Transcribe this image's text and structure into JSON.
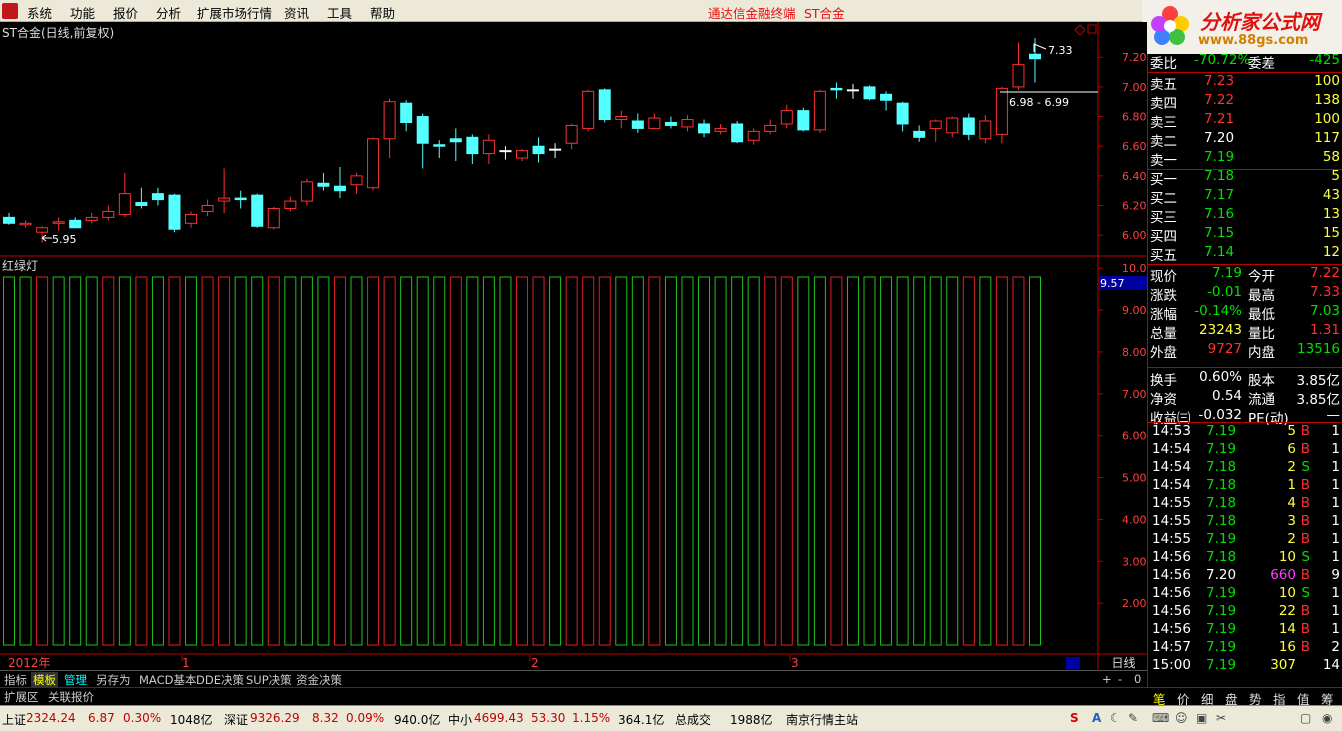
{
  "menu": [
    "系统",
    "功能",
    "报价",
    "分析",
    "扩展市场行情",
    "资讯",
    "工具",
    "帮助"
  ],
  "menu_center": [
    "通达信金融终端",
    "ST合金"
  ],
  "brand": {
    "title": "分析家公式网",
    "url": "www.88gs.com"
  },
  "stock_title": "ST合金(日线,前复权)",
  "indicator_title": "红绿灯",
  "price_axis": [
    "7.20",
    "7.00",
    "6.80",
    "6.60",
    "6.40",
    "6.20",
    "6.00"
  ],
  "ind_axis": [
    "10.00",
    "9.00",
    "8.00",
    "7.00",
    "6.00",
    "5.00",
    "4.00",
    "3.00",
    "2.00"
  ],
  "ind_current": "9.57",
  "annotations": {
    "high": "7.33",
    "low": "5.95",
    "range": "6.98 - 6.99"
  },
  "time_axis": {
    "year": "2012年",
    "m1": "1",
    "m2": "2",
    "m3": "3",
    "period": "日线"
  },
  "tabs": [
    "指标",
    "模板",
    "管理",
    "另存为",
    "MACD基本",
    "DDE决策",
    "SUP决策",
    "资金决策"
  ],
  "tabs2": [
    "扩展区",
    "关联报价"
  ],
  "tab_right": [
    "+",
    "-",
    "0"
  ],
  "quote": {
    "wb": {
      "label": "委比",
      "value": "-70.72%",
      "label2": "委差",
      "value2": "-425"
    },
    "sell": [
      {
        "l": "卖五",
        "p": "7.23",
        "v": "100"
      },
      {
        "l": "卖四",
        "p": "7.22",
        "v": "138"
      },
      {
        "l": "卖三",
        "p": "7.21",
        "v": "100"
      },
      {
        "l": "卖二",
        "p": "7.20",
        "v": "117"
      },
      {
        "l": "卖一",
        "p": "7.19",
        "v": "58"
      }
    ],
    "buy": [
      {
        "l": "买一",
        "p": "7.18",
        "v": "5"
      },
      {
        "l": "买二",
        "p": "7.17",
        "v": "43"
      },
      {
        "l": "买三",
        "p": "7.16",
        "v": "13"
      },
      {
        "l": "买四",
        "p": "7.15",
        "v": "15"
      },
      {
        "l": "买五",
        "p": "7.14",
        "v": "12"
      }
    ],
    "stats": [
      {
        "l1": "现价",
        "v1": "7.19",
        "l2": "今开",
        "v2": "7.22"
      },
      {
        "l1": "涨跌",
        "v1": "-0.01",
        "l2": "最高",
        "v2": "7.33"
      },
      {
        "l1": "涨幅",
        "v1": "-0.14%",
        "l2": "最低",
        "v2": "7.03"
      },
      {
        "l1": "总量",
        "v1": "23243",
        "l2": "量比",
        "v2": "1.31"
      },
      {
        "l1": "外盘",
        "v1": "9727",
        "l2": "内盘",
        "v2": "13516"
      }
    ],
    "stats2": [
      {
        "l1": "换手",
        "v1": "0.60%",
        "l2": "股本",
        "v2": "3.85亿"
      },
      {
        "l1": "净资",
        "v1": "0.54",
        "l2": "流通",
        "v2": "3.85亿"
      },
      {
        "l1": "收益㈢",
        "v1": "-0.032",
        "l2": "PE(动)",
        "v2": "—"
      }
    ],
    "ticks": [
      [
        "14:53",
        "7.19",
        "5",
        "B",
        "1"
      ],
      [
        "14:54",
        "7.19",
        "6",
        "B",
        "1"
      ],
      [
        "14:54",
        "7.18",
        "2",
        "S",
        "1"
      ],
      [
        "14:54",
        "7.18",
        "1",
        "B",
        "1"
      ],
      [
        "14:55",
        "7.18",
        "4",
        "B",
        "1"
      ],
      [
        "14:55",
        "7.18",
        "3",
        "B",
        "1"
      ],
      [
        "14:55",
        "7.19",
        "2",
        "B",
        "1"
      ],
      [
        "14:56",
        "7.18",
        "10",
        "S",
        "1"
      ],
      [
        "14:56",
        "7.20",
        "660",
        "B",
        "9"
      ],
      [
        "14:56",
        "7.19",
        "10",
        "S",
        "1"
      ],
      [
        "14:56",
        "7.19",
        "22",
        "B",
        "1"
      ],
      [
        "14:56",
        "7.19",
        "14",
        "B",
        "1"
      ],
      [
        "14:57",
        "7.19",
        "16",
        "B",
        "2"
      ],
      [
        "15:00",
        "7.19",
        "307",
        "",
        "14"
      ]
    ],
    "bottom_tabs": [
      "笔",
      "价",
      "细",
      "盘",
      "势",
      "指",
      "值",
      "筹"
    ]
  },
  "status": {
    "sh": {
      "name": "上证",
      "idx": "2324.24",
      "chg": "6.87",
      "pct": "0.30%",
      "amt": "1048亿"
    },
    "sz": {
      "name": "深证",
      "idx": "9326.29",
      "chg": "8.32",
      "pct": "0.09%",
      "amt": "940.0亿"
    },
    "zx": {
      "name": "中小",
      "idx": "4699.43",
      "chg": "53.30",
      "pct": "1.15%",
      "amt": "364.1亿"
    },
    "total_label": "总成交",
    "total": "1988亿",
    "site": "南京行情主站"
  },
  "chart_data": {
    "type": "candlestick",
    "ylim": [
      5.9,
      7.35
    ],
    "candles": [
      [
        6.12,
        6.08,
        6.15,
        6.07
      ],
      [
        6.07,
        6.08,
        6.1,
        6.05
      ],
      [
        6.02,
        6.05,
        6.06,
        5.95
      ],
      [
        6.08,
        6.09,
        6.12,
        6.03
      ],
      [
        6.1,
        6.05,
        6.12,
        6.05
      ],
      [
        6.1,
        6.12,
        6.15,
        6.08
      ],
      [
        6.12,
        6.16,
        6.2,
        6.1
      ],
      [
        6.14,
        6.28,
        6.42,
        6.12
      ],
      [
        6.22,
        6.2,
        6.32,
        6.18
      ],
      [
        6.28,
        6.24,
        6.32,
        6.2
      ],
      [
        6.27,
        6.04,
        6.28,
        6.02
      ],
      [
        6.08,
        6.14,
        6.16,
        6.05
      ],
      [
        6.16,
        6.2,
        6.24,
        6.13
      ],
      [
        6.23,
        6.25,
        6.45,
        6.15
      ],
      [
        6.25,
        6.24,
        6.3,
        6.18
      ],
      [
        6.27,
        6.06,
        6.28,
        6.05
      ],
      [
        6.05,
        6.18,
        6.19,
        6.04
      ],
      [
        6.18,
        6.23,
        6.26,
        6.16
      ],
      [
        6.23,
        6.36,
        6.38,
        6.2
      ],
      [
        6.35,
        6.33,
        6.42,
        6.3
      ],
      [
        6.33,
        6.3,
        6.46,
        6.25
      ],
      [
        6.34,
        6.4,
        6.42,
        6.28
      ],
      [
        6.32,
        6.65,
        6.66,
        6.3
      ],
      [
        6.65,
        6.9,
        6.92,
        6.52
      ],
      [
        6.89,
        6.76,
        6.91,
        6.7
      ],
      [
        6.8,
        6.62,
        6.82,
        6.45
      ],
      [
        6.61,
        6.6,
        6.64,
        6.52
      ],
      [
        6.65,
        6.63,
        6.72,
        6.5
      ],
      [
        6.66,
        6.55,
        6.68,
        6.48
      ],
      [
        6.55,
        6.64,
        6.68,
        6.48
      ],
      [
        6.57,
        6.57,
        6.6,
        6.51
      ],
      [
        6.52,
        6.57,
        6.58,
        6.5
      ],
      [
        6.6,
        6.55,
        6.66,
        6.49
      ],
      [
        6.58,
        6.58,
        6.62,
        6.52
      ],
      [
        6.62,
        6.74,
        6.75,
        6.58
      ],
      [
        6.72,
        6.97,
        6.98,
        6.7
      ],
      [
        6.98,
        6.78,
        6.99,
        6.76
      ],
      [
        6.78,
        6.8,
        6.84,
        6.72
      ],
      [
        6.77,
        6.72,
        6.82,
        6.69
      ],
      [
        6.72,
        6.79,
        6.82,
        6.74
      ],
      [
        6.76,
        6.74,
        6.8,
        6.72
      ],
      [
        6.73,
        6.78,
        6.81,
        6.7
      ],
      [
        6.75,
        6.69,
        6.78,
        6.66
      ],
      [
        6.7,
        6.72,
        6.75,
        6.68
      ],
      [
        6.75,
        6.63,
        6.77,
        6.62
      ],
      [
        6.64,
        6.7,
        6.72,
        6.61
      ],
      [
        6.7,
        6.74,
        6.78,
        6.68
      ],
      [
        6.75,
        6.84,
        6.88,
        6.72
      ],
      [
        6.84,
        6.71,
        6.86,
        6.7
      ],
      [
        6.71,
        6.97,
        6.98,
        6.69
      ],
      [
        6.99,
        6.98,
        7.03,
        6.92
      ],
      [
        6.98,
        6.98,
        7.02,
        6.92
      ],
      [
        7.0,
        6.92,
        7.01,
        6.91
      ],
      [
        6.95,
        6.91,
        6.97,
        6.84
      ],
      [
        6.89,
        6.75,
        6.9,
        6.7
      ],
      [
        6.7,
        6.66,
        6.74,
        6.63
      ],
      [
        6.72,
        6.77,
        6.78,
        6.63
      ],
      [
        6.69,
        6.79,
        6.8,
        6.66
      ],
      [
        6.79,
        6.68,
        6.82,
        6.64
      ],
      [
        6.65,
        6.77,
        6.81,
        6.62
      ],
      [
        6.68,
        6.99,
        7.0,
        6.62
      ],
      [
        7.0,
        7.15,
        7.3,
        6.98
      ],
      [
        7.22,
        7.19,
        7.33,
        7.03
      ]
    ],
    "signal_colors_note": "alternating red/green signal bars",
    "signals": [
      "g",
      "g",
      "r",
      "g",
      "g",
      "g",
      "r",
      "g",
      "r",
      "g",
      "r",
      "g",
      "r",
      "r",
      "g",
      "g",
      "r",
      "g",
      "g",
      "g",
      "r",
      "g",
      "r",
      "r",
      "g",
      "g",
      "g",
      "r",
      "g",
      "g",
      "g",
      "r",
      "r",
      "g",
      "r",
      "r",
      "r",
      "g",
      "g",
      "r",
      "g",
      "g",
      "g",
      "g",
      "g",
      "g",
      "r",
      "r",
      "g",
      "g",
      "r",
      "g",
      "g",
      "g",
      "g",
      "g",
      "g",
      "g",
      "r",
      "g",
      "r",
      "r",
      "g"
    ]
  }
}
